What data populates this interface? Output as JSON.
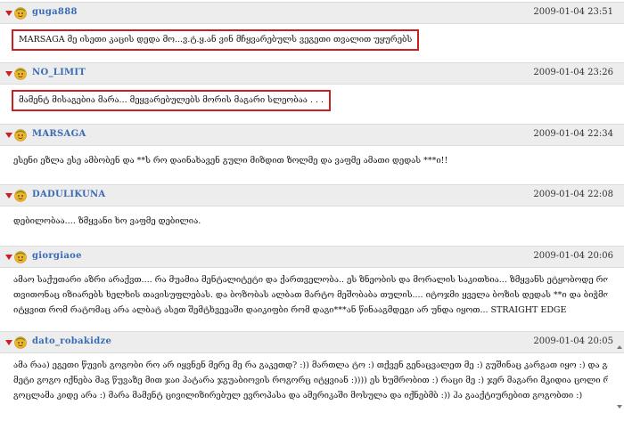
{
  "comments": [
    {
      "user": "guga888",
      "date": "2009-01-04 23:51",
      "text": "MARSAGA მე ისეთი კაცის დედა მო...ვ.ტ.ყ.ან ვინ მჩყვარებულს ვეგეთი თვალით უყურებს",
      "highlighted": true
    },
    {
      "user": "NO_LIMIT",
      "date": "2009-01-04 23:26",
      "text": "მამენტ მისაგებია მარა... მეყვარებულებს მორის მაგარი სლეობაა . . .",
      "highlighted": true
    },
    {
      "user": "MARSAGA",
      "date": "2009-01-04 22:34",
      "text": "ესენი ეზლა ესე ამბობენ და **ს რო დაინახავენ გული მიზდით ზოლმე და ვაფმე ამათი დედას ***ი!!",
      "highlighted": false
    },
    {
      "user": "DADULIKUNA",
      "date": "2009-01-04 22:08",
      "text": "დებილობაა.... ზმყვანი ხო ვაფმე დებილია.",
      "highlighted": false
    },
    {
      "user": "giorgiaoe",
      "date": "2009-01-04 20:06",
      "lines": [
        "ამაო საქუთარი აზრი არაქვთ.... რა მუამია მენტალიტეტი და ქართველობა.. ეს ზნეობის და მორალის საკითხია... ზმყვანს ეტყობოდე რომ",
        "თვითონაც იზიარებს ხელხის თავისუფლებას. და ბოზობას ალბათ მარტო მეშობაბა თულის.... იტოჯმი ყველა ბოზის დედას **ი და ბიჭმო ვინც",
        "იტყვით რომ რატომაც არა ალბატ ასეთ შემტხვევაში დაიკიფბი რომ დაგი***ან წინააგმდეგი არ უნდა იყოთ... STRAIGHT EDGE"
      ],
      "highlighted": false
    },
    {
      "user": "dato_robakidze",
      "date": "2009-01-04 20:05",
      "lines": [
        "ამა რაა) ეგეთი წუვის გოგობი რო არ იყვნენ მერე მე რა გაკეთდ? :)) მართლა ტო :) თქვენ გენაცვალეთ მე :) გუშინაც კარგათ იყო :) და გამმე რაც",
        "მეტი გოგო იქნება მაგ წუვაზე მით ჯაი პატარა ჯგუაბიოვის როგორც იტყვიან :)))) ეს ხუმრობით :) რაცი მე :) ჯერ მაგარი მკიდია ცოლი რა :) და",
        "გოცლამა კიდე არა :) მარა მამენტ ცივილიზირებულ ევროპასა და ამერიკაში მოსულა და იქნებმბ :)) ჰა გააქტიურებით გოგობთი :)"
      ],
      "highlighted": false
    }
  ]
}
